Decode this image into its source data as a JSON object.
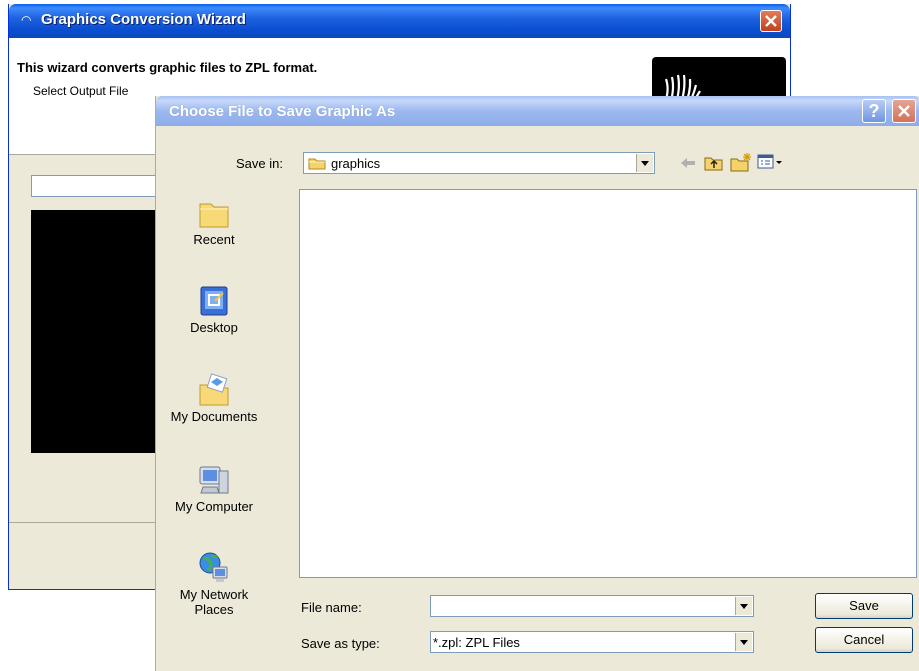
{
  "wizard": {
    "title": "Graphics Conversion Wizard",
    "heading": "This wizard converts graphic files to ZPL format.",
    "subheading": "Select Output File"
  },
  "dialog": {
    "title": "Choose File to Save Graphic As",
    "help_label": "?",
    "save_in_label": "Save in:",
    "save_in_value": "graphics",
    "places": [
      "Recent",
      "Desktop",
      "My Documents",
      "My Computer",
      "My Network Places"
    ],
    "file_name_label": "File name:",
    "file_name_value": "",
    "save_as_type_label": "Save as type:",
    "save_as_type_value": "*.zpl: ZPL Files",
    "save_button": "Save",
    "cancel_button": "Cancel"
  },
  "colors": {
    "wizard_titlebar": "#0a4fd1",
    "dialog_titlebar_inactive": "#9cb8ee",
    "face": "#ece9d8",
    "close_red": "#c2411d"
  },
  "icons": [
    "back-icon",
    "up-folder-icon",
    "new-folder-icon",
    "views-menu-icon",
    "folder-icon",
    "recent-icon",
    "desktop-icon",
    "my-documents-icon",
    "my-computer-icon",
    "my-network-places-icon"
  ]
}
